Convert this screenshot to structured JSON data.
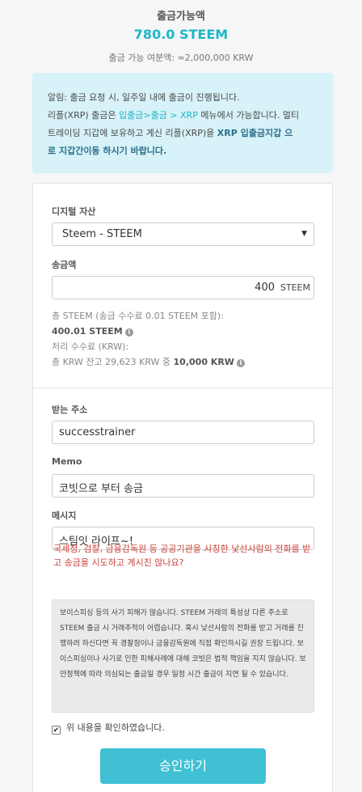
{
  "header": {
    "title": "출금가능액",
    "amount": "780.0 STEEM",
    "sub": "출금 가능 여분액: ≈2,000,000 KRW"
  },
  "notice": {
    "line1": "알림: 출금 요청 시, 일주일 내에 출금이 진행됩니다.",
    "line2_a": "리플(XRP) 출금은 ",
    "line2_link": "입출금>출금 > XRP",
    "line2_b": " 메뉴에서 가능합니다. 멀티",
    "line3": "트레이딩 지갑에 보유하고 계신 리플(XRP)을 ",
    "line3_bold": "XRP 입출금지갑 으",
    "line4_bold": "로 지갑간이동 하시기 바랍니다."
  },
  "form": {
    "asset_label": "디지털 자산",
    "asset_value": "Steem - STEEM",
    "amount_label": "송금액",
    "amount_value": "400",
    "amount_unit": "STEEM",
    "total_label": "총 STEEM (송금 수수료 0.01 STEEM 포함):",
    "total_value": "400.01 STEEM",
    "fee_label": "처리 수수료 (KRW):",
    "fee_text_a": "총 KRW 잔고 29,623 KRW 중 ",
    "fee_text_b": "10,000 KRW",
    "address_label": "받는 주소",
    "address_value": "successtrainer",
    "memo_label": "Memo",
    "memo_value": "코빗으로 부터 송금",
    "message_label": "메시지",
    "message_value": "스팀잇 라이프~!",
    "warning": "국세청, 검찰, 금융감독원 등 공공기관을 사칭한 낯선사람의 전화를 받고 송금을 시도하고 계시진 않나요?",
    "disclaimer": "보이스피싱 등의 사기 피해가 많습니다. STEEM 거래의 특성상 다른 주소로 STEEM 출금 시 거래추적이 어렵습니다. 혹시 낯선사람의 전화를 받고 거래를 진행하려 하신다면 꼭 경찰청이나 금융감독원에 직접 확인하시길 권장 드립니다. 보이스피싱이나 사기로 인한 피해사례에 대해 코빗은 법적 책임을 지지 않습니다. 보안정책에 따라 의심되는 출금일 경우 일정 시간 출금이 지연 될 수 있습니다.",
    "confirm_label": "위 내용을 확인하였습니다.",
    "confirm_checked": true,
    "submit_label": "승인하기"
  },
  "colors": {
    "accent": "#1fb6c7",
    "notice_bg": "#d7f2f8",
    "warning": "#c9443c",
    "button": "#3fc0d3"
  }
}
